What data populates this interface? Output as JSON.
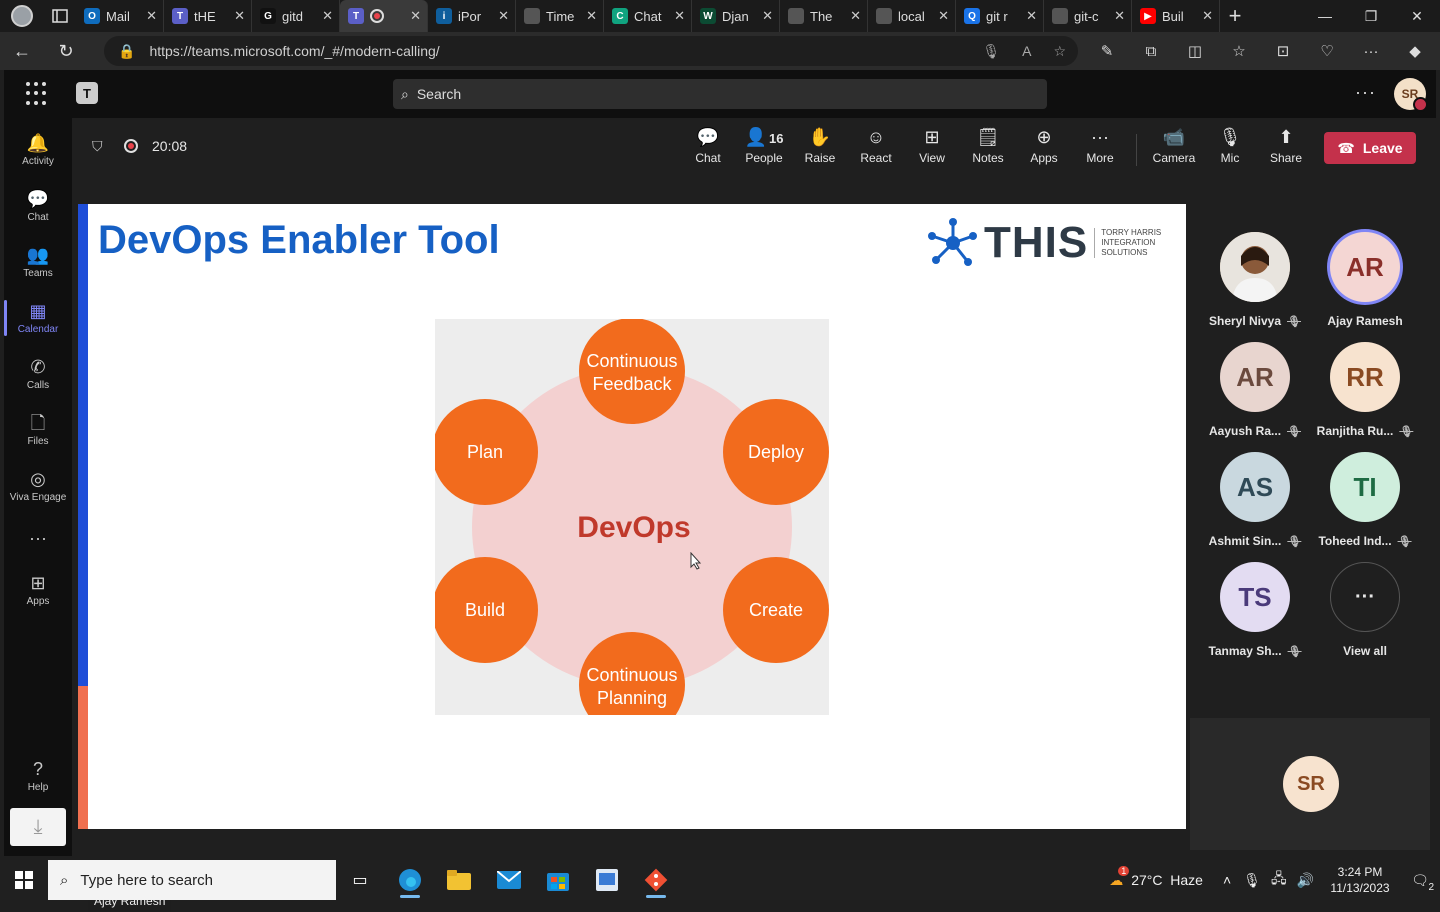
{
  "browser": {
    "tabs": [
      {
        "title": "Mail",
        "fav_color": "#0f6cbd",
        "fav": "O"
      },
      {
        "title": "tHE",
        "fav_color": "#5b5fc7",
        "fav": "T"
      },
      {
        "title": "gitd",
        "fav_color": "#111111",
        "fav": "G"
      },
      {
        "title": "",
        "fav_color": "#5b5fc7",
        "fav": "T",
        "active": true
      },
      {
        "title": "iPor",
        "fav_color": "#0f5e9c",
        "fav": "i"
      },
      {
        "title": "Time",
        "fav_color": "#555555",
        "fav": ""
      },
      {
        "title": "Chat",
        "fav_color": "#10a37f",
        "fav": "C"
      },
      {
        "title": "Djan",
        "fav_color": "#0c4b33",
        "fav": "W"
      },
      {
        "title": "The",
        "fav_color": "#555555",
        "fav": ""
      },
      {
        "title": "local",
        "fav_color": "#555555",
        "fav": ""
      },
      {
        "title": "git r",
        "fav_color": "#1a73e8",
        "fav": "Q"
      },
      {
        "title": "git-c",
        "fav_color": "#555555",
        "fav": ""
      },
      {
        "title": "Buil",
        "fav_color": "#ff0000",
        "fav": "▶"
      }
    ],
    "url": "https://teams.microsoft.com/_#/modern-calling/"
  },
  "teams": {
    "search_placeholder": "Search",
    "user_initials": "SR",
    "rail": [
      {
        "label": "Activity",
        "icon": "bell-icon",
        "glyph": "🔔"
      },
      {
        "label": "Chat",
        "icon": "chat-icon",
        "glyph": "💬"
      },
      {
        "label": "Teams",
        "icon": "teams-icon",
        "glyph": "👥"
      },
      {
        "label": "Calendar",
        "icon": "calendar-icon",
        "glyph": "▦",
        "active": true
      },
      {
        "label": "Calls",
        "icon": "phone-icon",
        "glyph": "✆"
      },
      {
        "label": "Files",
        "icon": "file-icon",
        "glyph": "🗋"
      },
      {
        "label": "Viva Engage",
        "icon": "viva-engage-icon",
        "glyph": "◎"
      },
      {
        "label": "",
        "icon": "more-icon",
        "glyph": "···"
      },
      {
        "label": "Apps",
        "icon": "apps-icon",
        "glyph": "⊞"
      }
    ],
    "help_label": "Help"
  },
  "meeting": {
    "timer": "20:08",
    "people_count": "16",
    "controls": [
      {
        "label": "Chat",
        "icon": "chat-icon",
        "glyph": "💬"
      },
      {
        "label": "People",
        "icon": "people-icon",
        "glyph": "👤"
      },
      {
        "label": "Raise",
        "icon": "raise-hand-icon",
        "glyph": "✋"
      },
      {
        "label": "React",
        "icon": "react-icon",
        "glyph": "☺"
      },
      {
        "label": "View",
        "icon": "view-icon",
        "glyph": "⊞"
      },
      {
        "label": "Notes",
        "icon": "notes-icon",
        "glyph": "🗒"
      },
      {
        "label": "Apps",
        "icon": "apps-icon",
        "glyph": "⊕"
      },
      {
        "label": "More",
        "icon": "more-icon",
        "glyph": "···"
      }
    ],
    "media_controls": [
      {
        "label": "Camera",
        "icon": "camera-off-icon",
        "glyph": "📹"
      },
      {
        "label": "Mic",
        "icon": "mic-off-icon",
        "glyph": "🎙"
      },
      {
        "label": "Share",
        "icon": "share-icon",
        "glyph": "⬆"
      }
    ],
    "leave_label": "Leave"
  },
  "slide": {
    "title": "DevOps Enabler Tool",
    "logo_word": "THIS",
    "logo_tagline": "TORRY HARRIS INTEGRATION SOLUTIONS",
    "center_label": "DevOps",
    "stages": [
      "Continuous Feedback",
      "Deploy",
      "Create",
      "Continuous Planning",
      "Build",
      "Plan"
    ],
    "presenter_name": "Ajay Ramesh",
    "colors": {
      "orange": "#f26b1d",
      "center_text": "#c0392b",
      "pink": "#f3d0d0",
      "gray": "#ededed"
    }
  },
  "participants": [
    {
      "name": "Sheryl Nivya",
      "initials": "",
      "photo": true,
      "muted": true,
      "bg": "#d8b48a",
      "fg": "#6b3d1e"
    },
    {
      "name": "Ajay Ramesh",
      "initials": "AR",
      "speaking": true,
      "muted": false,
      "bg": "#f4d6d3",
      "fg": "#8a2f2a"
    },
    {
      "name": "Aayush Ra...",
      "initials": "AR",
      "muted": true,
      "bg": "#e8d5cf",
      "fg": "#6b4a3e"
    },
    {
      "name": "Ranjitha Ru...",
      "initials": "RR",
      "muted": true,
      "bg": "#f7e3cf",
      "fg": "#8a4a22"
    },
    {
      "name": "Ashmit Sin...",
      "initials": "AS",
      "muted": true,
      "bg": "#c9d8df",
      "fg": "#2f4a57"
    },
    {
      "name": "Toheed Ind...",
      "initials": "TI",
      "muted": true,
      "bg": "#cfeedd",
      "fg": "#1e6b43"
    },
    {
      "name": "Tanmay Sh...",
      "initials": "TS",
      "muted": true,
      "bg": "#e3dcf2",
      "fg": "#4a3a7a"
    },
    {
      "name": "View all",
      "initials": "···",
      "muted": false,
      "bg": "#1f1f1f",
      "fg": "#e6e6e6"
    }
  ],
  "self": {
    "initials": "SR"
  },
  "taskbar": {
    "search_placeholder": "Type here to search",
    "weather": "27°C  Haze",
    "weather_badge": "1",
    "time": "3:24 PM",
    "date": "11/13/2023",
    "notifications": "2"
  }
}
